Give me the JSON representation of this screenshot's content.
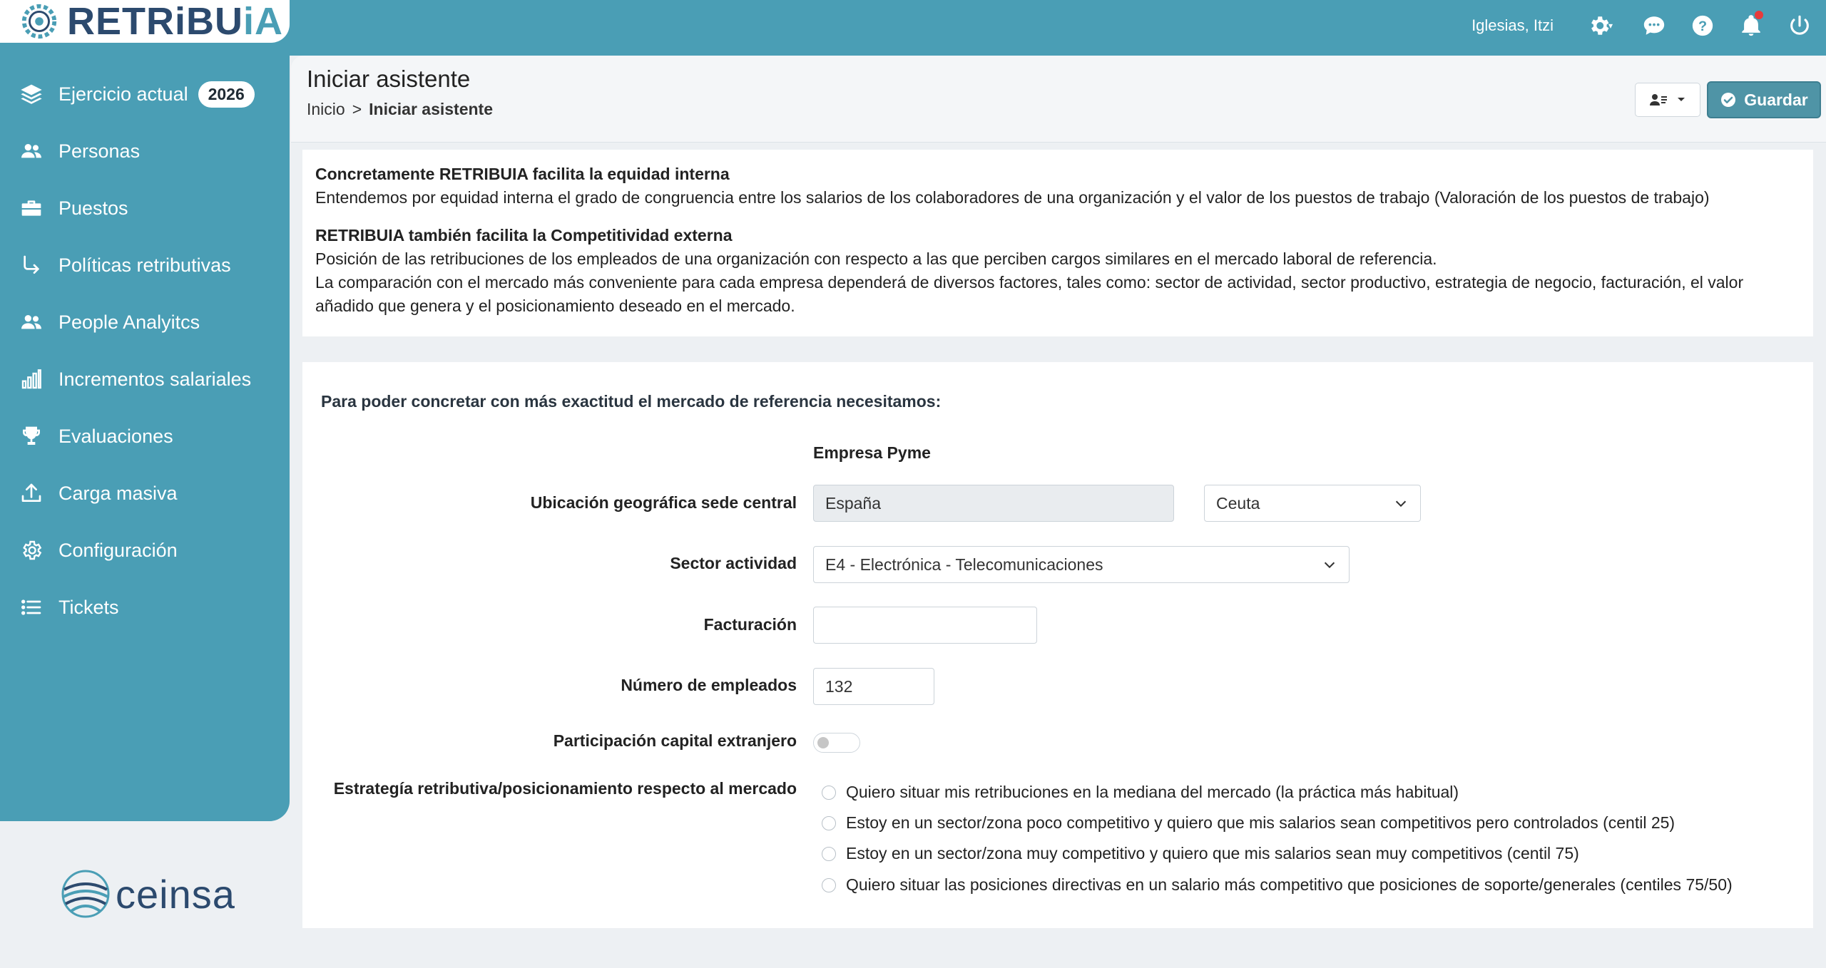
{
  "app": {
    "logo_text_a": "RETRiBU",
    "logo_text_b": "iA",
    "user_name": "Iglesias, Itzi"
  },
  "sidebar": {
    "items": [
      {
        "label": "Ejercicio actual",
        "badge": "2026",
        "icon": "layers-icon"
      },
      {
        "label": "Personas",
        "icon": "users-icon"
      },
      {
        "label": "Puestos",
        "icon": "briefcase-icon"
      },
      {
        "label": "Políticas retributivas",
        "icon": "arrow-turn-icon"
      },
      {
        "label": "People Analyitcs",
        "icon": "users-icon"
      },
      {
        "label": "Incrementos salariales",
        "icon": "bar-chart-icon"
      },
      {
        "label": "Evaluaciones",
        "icon": "trophy-icon"
      },
      {
        "label": "Carga masiva",
        "icon": "upload-icon"
      },
      {
        "label": "Configuración",
        "icon": "gear-icon"
      },
      {
        "label": "Tickets",
        "icon": "list-icon"
      }
    ],
    "brand": "ceinsa"
  },
  "header": {
    "title": "Iniciar asistente",
    "breadcrumb_home": "Inicio",
    "breadcrumb_sep": ">",
    "breadcrumb_current": "Iniciar asistente",
    "save_label": "Guardar"
  },
  "info": {
    "heading1": "Concretamente RETRIBUIA facilita la equidad interna",
    "text1": "Entendemos por equidad interna el grado de congruencia entre los salarios de los colaboradores de una organización y el valor de los puestos de trabajo (Valoración de los puestos de trabajo)",
    "heading2": "RETRIBUIA también facilita la Competitividad externa",
    "text2": "Posición de las retribuciones de los empleados de una organización con respecto a las que perciben cargos similares en el mercado laboral de referencia.",
    "text3": "La comparación con el mercado más conveniente para cada empresa dependerá de diversos factores, tales como: sector de actividad, sector productivo, estrategia de negocio, facturación, el valor",
    "text3b": "añadido que genera y el posicionamiento deseado en el mercado."
  },
  "form": {
    "intro": "Para poder concretar con más exactitud el mercado de referencia necesitamos:",
    "company_type": "Empresa Pyme",
    "location_label": "Ubicación geográfica sede central",
    "country_value": "España",
    "region_value": "Ceuta",
    "sector_label": "Sector actividad",
    "sector_value": "E4 - Electrónica - Telecomunicaciones",
    "revenue_label": "Facturación",
    "revenue_value": "",
    "employees_label": "Número de empleados",
    "employees_value": "132",
    "foreign_label": "Participación capital extranjero",
    "foreign_enabled": false,
    "strategy_label": "Estrategía retributiva/posicionamiento respecto al mercado",
    "strategy_options": [
      "Quiero situar mis retribuciones en la mediana del mercado (la práctica más habitual)",
      "Estoy en un sector/zona poco competitivo y quiero que mis salarios sean competitivos pero controlados (centil 25)",
      "Estoy en un sector/zona muy competitivo y quiero que mis salarios sean muy competitivos (centil 75)",
      "Quiero situar las posiciones directivas en un salario más competitivo que posiciones de soporte/generales (centiles 75/50)"
    ]
  },
  "colors": {
    "primary": "#4a9eb5",
    "brand_dark": "#2c4a6e",
    "save_button": "#4f94a6",
    "notification": "#e83b3b"
  }
}
